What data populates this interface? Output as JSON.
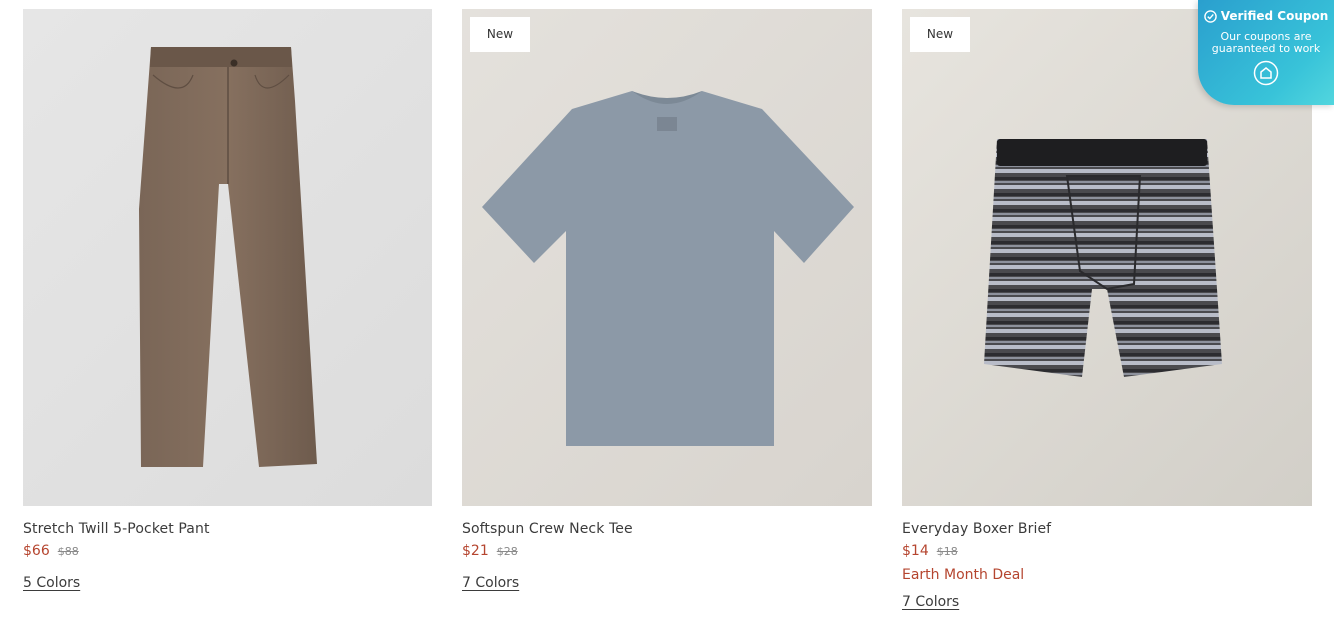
{
  "products": [
    {
      "title": "Stretch Twill 5-Pocket Pant",
      "price": "$66",
      "old_price": "$88",
      "badge": "",
      "deal": "",
      "colors": "5 Colors",
      "image_icon": "brown-pant-image"
    },
    {
      "title": "Softspun Crew Neck Tee",
      "price": "$21",
      "old_price": "$28",
      "badge": "New",
      "deal": "",
      "colors": "7 Colors",
      "image_icon": "gray-tee-image"
    },
    {
      "title": "Everyday Boxer Brief",
      "price": "$14",
      "old_price": "$18",
      "badge": "New",
      "deal": "Earth Month Deal",
      "colors": "7 Colors",
      "image_icon": "striped-boxer-image"
    }
  ],
  "coupon": {
    "title": "Verified Coupon",
    "subtitle": "Our coupons are guaranteed to work",
    "accent": "#2a9fce"
  },
  "colors": {
    "sale_price": "#b5452f",
    "text": "#3b3b3b"
  }
}
